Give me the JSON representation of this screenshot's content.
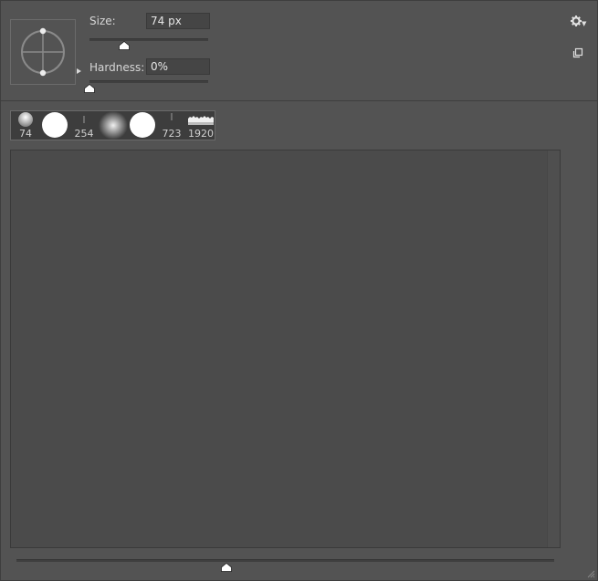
{
  "brush": {
    "size_label": "Size:",
    "size_value": "74 px",
    "size_level": 0.29,
    "hardness_label": "Hardness:",
    "hardness_value": "0%",
    "hardness_level": 0.0
  },
  "recent_brushes": [
    "74",
    "",
    "254",
    "",
    "",
    "723",
    "1920"
  ],
  "thumbnail_size_level": 0.39,
  "icons": {
    "settings": "gear-icon",
    "new_preset": "new-preset-icon",
    "flyout": "triangle-right-icon",
    "grip": "resize-grip-icon"
  },
  "colors": {
    "panel": "#535353",
    "field": "#454545",
    "presets_bg": "#4b4b4b",
    "thumb": "#ffffff"
  }
}
